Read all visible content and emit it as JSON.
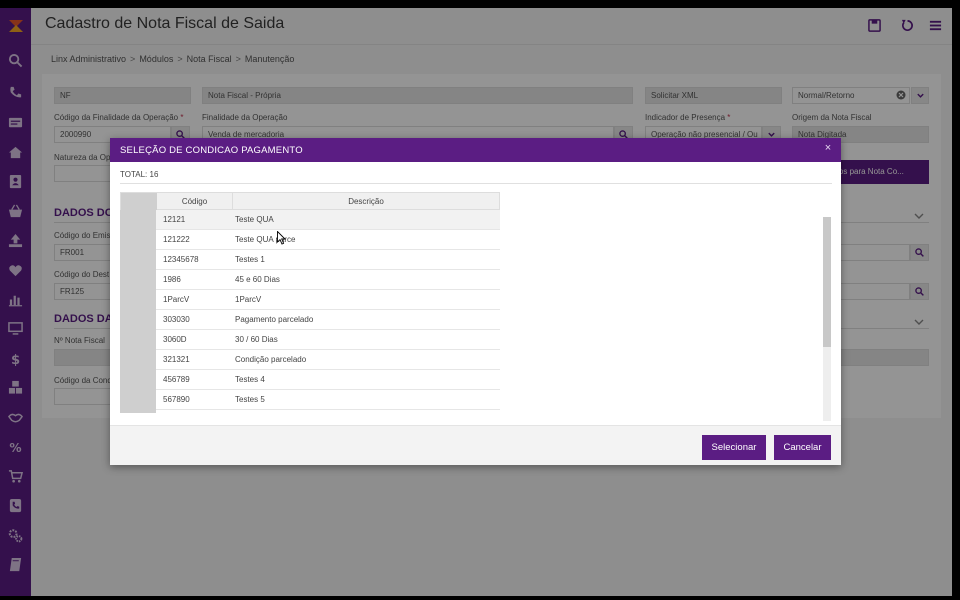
{
  "header": {
    "title": "Cadastro de Nota Fiscal de Saida",
    "breadcrumb": [
      "Linx Administrativo",
      "Módulos",
      "Nota Fiscal",
      "Manutenção"
    ],
    "breadcrumb_sep": ">"
  },
  "sidebar": {
    "icons": [
      "search-icon",
      "phone-icon",
      "id-card-icon",
      "home-icon",
      "contact-icon",
      "basket-icon",
      "upload-icon",
      "heart-icon",
      "bar-chart-icon",
      "monitor-icon",
      "dollar-icon",
      "cubes-icon",
      "handshake-icon",
      "percent-icon",
      "cart-icon",
      "phone-book-icon",
      "gears-icon",
      "book-icon"
    ]
  },
  "form": {
    "row0": {
      "field1": "NF",
      "field2": "Nota Fiscal - Própria",
      "field3": "Solicitar XML",
      "field4": "Normal/Retorno"
    },
    "row1": {
      "finalidade_codigo_label": "Código da Finalidade da Operação",
      "finalidade_codigo_value": "2000990",
      "finalidade_label": "Finalidade da Operação",
      "finalidade_value": "Venda de mercadoria",
      "presenca_label": "Indicador de Presença",
      "presenca_value": "Operação não presencial / Ou",
      "origem_label": "Origem da Nota Fiscal",
      "origem_value": "Nota Digitada"
    },
    "natureza_label": "Natureza da Op",
    "dados_button": "ados para Nota Co...",
    "section1_title": "DADOS DO",
    "emit_label": "Código do Emis",
    "emit_value": "FR001",
    "dest_label": "Código do Dest",
    "dest_value": "FR125",
    "section2_title": "DADOS DA",
    "nf_label": "Nº Nota Fiscal",
    "cond_label": "Código da Cond"
  },
  "modal": {
    "title": "SELEÇÃO DE CONDICAO PAGAMENTO",
    "close": "×",
    "total": "TOTAL: 16",
    "columns": [
      "Código",
      "Descrição"
    ],
    "rows": [
      {
        "codigo": "12121",
        "descricao": "Teste QUA"
      },
      {
        "codigo": "121222",
        "descricao": "Teste QUA parce"
      },
      {
        "codigo": "12345678",
        "descricao": "Testes 1"
      },
      {
        "codigo": "1986",
        "descricao": "45 e 60 Dias"
      },
      {
        "codigo": "1ParcV",
        "descricao": "1ParcV"
      },
      {
        "codigo": "303030",
        "descricao": "Pagamento parcelado"
      },
      {
        "codigo": "3060D",
        "descricao": "30 / 60 Dias"
      },
      {
        "codigo": "321321",
        "descricao": "Condição parcelado"
      },
      {
        "codigo": "456789",
        "descricao": "Testes 4"
      },
      {
        "codigo": "567890",
        "descricao": "Testes 5"
      }
    ],
    "select_button": "Selecionar",
    "cancel_button": "Cancelar"
  },
  "colors": {
    "brand": "#5b1d83",
    "required": "#c0304d"
  }
}
